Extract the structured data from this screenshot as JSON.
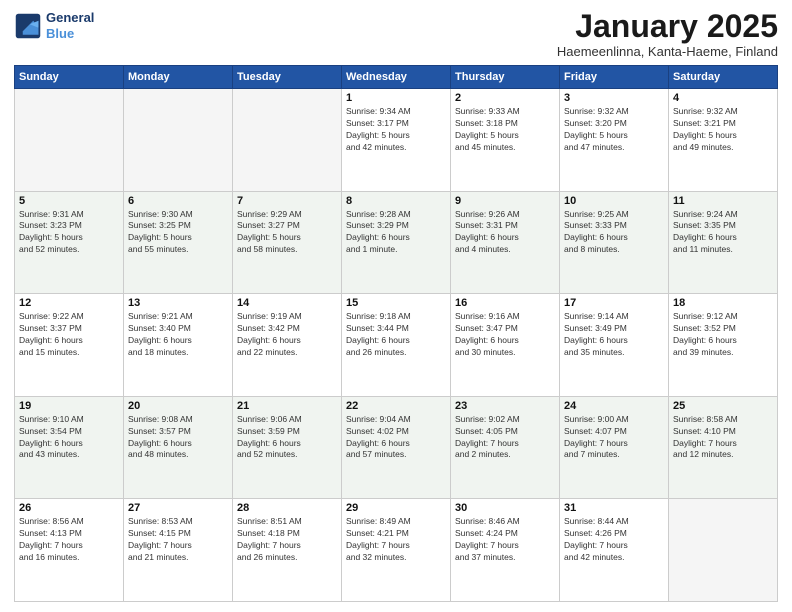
{
  "header": {
    "logo_line1": "General",
    "logo_line2": "Blue",
    "title": "January 2025",
    "location": "Haemeenlinna, Kanta-Haeme, Finland"
  },
  "weekdays": [
    "Sunday",
    "Monday",
    "Tuesday",
    "Wednesday",
    "Thursday",
    "Friday",
    "Saturday"
  ],
  "weeks": [
    [
      {
        "day": "",
        "info": ""
      },
      {
        "day": "",
        "info": ""
      },
      {
        "day": "",
        "info": ""
      },
      {
        "day": "1",
        "info": "Sunrise: 9:34 AM\nSunset: 3:17 PM\nDaylight: 5 hours\nand 42 minutes."
      },
      {
        "day": "2",
        "info": "Sunrise: 9:33 AM\nSunset: 3:18 PM\nDaylight: 5 hours\nand 45 minutes."
      },
      {
        "day": "3",
        "info": "Sunrise: 9:32 AM\nSunset: 3:20 PM\nDaylight: 5 hours\nand 47 minutes."
      },
      {
        "day": "4",
        "info": "Sunrise: 9:32 AM\nSunset: 3:21 PM\nDaylight: 5 hours\nand 49 minutes."
      }
    ],
    [
      {
        "day": "5",
        "info": "Sunrise: 9:31 AM\nSunset: 3:23 PM\nDaylight: 5 hours\nand 52 minutes."
      },
      {
        "day": "6",
        "info": "Sunrise: 9:30 AM\nSunset: 3:25 PM\nDaylight: 5 hours\nand 55 minutes."
      },
      {
        "day": "7",
        "info": "Sunrise: 9:29 AM\nSunset: 3:27 PM\nDaylight: 5 hours\nand 58 minutes."
      },
      {
        "day": "8",
        "info": "Sunrise: 9:28 AM\nSunset: 3:29 PM\nDaylight: 6 hours\nand 1 minute."
      },
      {
        "day": "9",
        "info": "Sunrise: 9:26 AM\nSunset: 3:31 PM\nDaylight: 6 hours\nand 4 minutes."
      },
      {
        "day": "10",
        "info": "Sunrise: 9:25 AM\nSunset: 3:33 PM\nDaylight: 6 hours\nand 8 minutes."
      },
      {
        "day": "11",
        "info": "Sunrise: 9:24 AM\nSunset: 3:35 PM\nDaylight: 6 hours\nand 11 minutes."
      }
    ],
    [
      {
        "day": "12",
        "info": "Sunrise: 9:22 AM\nSunset: 3:37 PM\nDaylight: 6 hours\nand 15 minutes."
      },
      {
        "day": "13",
        "info": "Sunrise: 9:21 AM\nSunset: 3:40 PM\nDaylight: 6 hours\nand 18 minutes."
      },
      {
        "day": "14",
        "info": "Sunrise: 9:19 AM\nSunset: 3:42 PM\nDaylight: 6 hours\nand 22 minutes."
      },
      {
        "day": "15",
        "info": "Sunrise: 9:18 AM\nSunset: 3:44 PM\nDaylight: 6 hours\nand 26 minutes."
      },
      {
        "day": "16",
        "info": "Sunrise: 9:16 AM\nSunset: 3:47 PM\nDaylight: 6 hours\nand 30 minutes."
      },
      {
        "day": "17",
        "info": "Sunrise: 9:14 AM\nSunset: 3:49 PM\nDaylight: 6 hours\nand 35 minutes."
      },
      {
        "day": "18",
        "info": "Sunrise: 9:12 AM\nSunset: 3:52 PM\nDaylight: 6 hours\nand 39 minutes."
      }
    ],
    [
      {
        "day": "19",
        "info": "Sunrise: 9:10 AM\nSunset: 3:54 PM\nDaylight: 6 hours\nand 43 minutes."
      },
      {
        "day": "20",
        "info": "Sunrise: 9:08 AM\nSunset: 3:57 PM\nDaylight: 6 hours\nand 48 minutes."
      },
      {
        "day": "21",
        "info": "Sunrise: 9:06 AM\nSunset: 3:59 PM\nDaylight: 6 hours\nand 52 minutes."
      },
      {
        "day": "22",
        "info": "Sunrise: 9:04 AM\nSunset: 4:02 PM\nDaylight: 6 hours\nand 57 minutes."
      },
      {
        "day": "23",
        "info": "Sunrise: 9:02 AM\nSunset: 4:05 PM\nDaylight: 7 hours\nand 2 minutes."
      },
      {
        "day": "24",
        "info": "Sunrise: 9:00 AM\nSunset: 4:07 PM\nDaylight: 7 hours\nand 7 minutes."
      },
      {
        "day": "25",
        "info": "Sunrise: 8:58 AM\nSunset: 4:10 PM\nDaylight: 7 hours\nand 12 minutes."
      }
    ],
    [
      {
        "day": "26",
        "info": "Sunrise: 8:56 AM\nSunset: 4:13 PM\nDaylight: 7 hours\nand 16 minutes."
      },
      {
        "day": "27",
        "info": "Sunrise: 8:53 AM\nSunset: 4:15 PM\nDaylight: 7 hours\nand 21 minutes."
      },
      {
        "day": "28",
        "info": "Sunrise: 8:51 AM\nSunset: 4:18 PM\nDaylight: 7 hours\nand 26 minutes."
      },
      {
        "day": "29",
        "info": "Sunrise: 8:49 AM\nSunset: 4:21 PM\nDaylight: 7 hours\nand 32 minutes."
      },
      {
        "day": "30",
        "info": "Sunrise: 8:46 AM\nSunset: 4:24 PM\nDaylight: 7 hours\nand 37 minutes."
      },
      {
        "day": "31",
        "info": "Sunrise: 8:44 AM\nSunset: 4:26 PM\nDaylight: 7 hours\nand 42 minutes."
      },
      {
        "day": "",
        "info": ""
      }
    ]
  ]
}
